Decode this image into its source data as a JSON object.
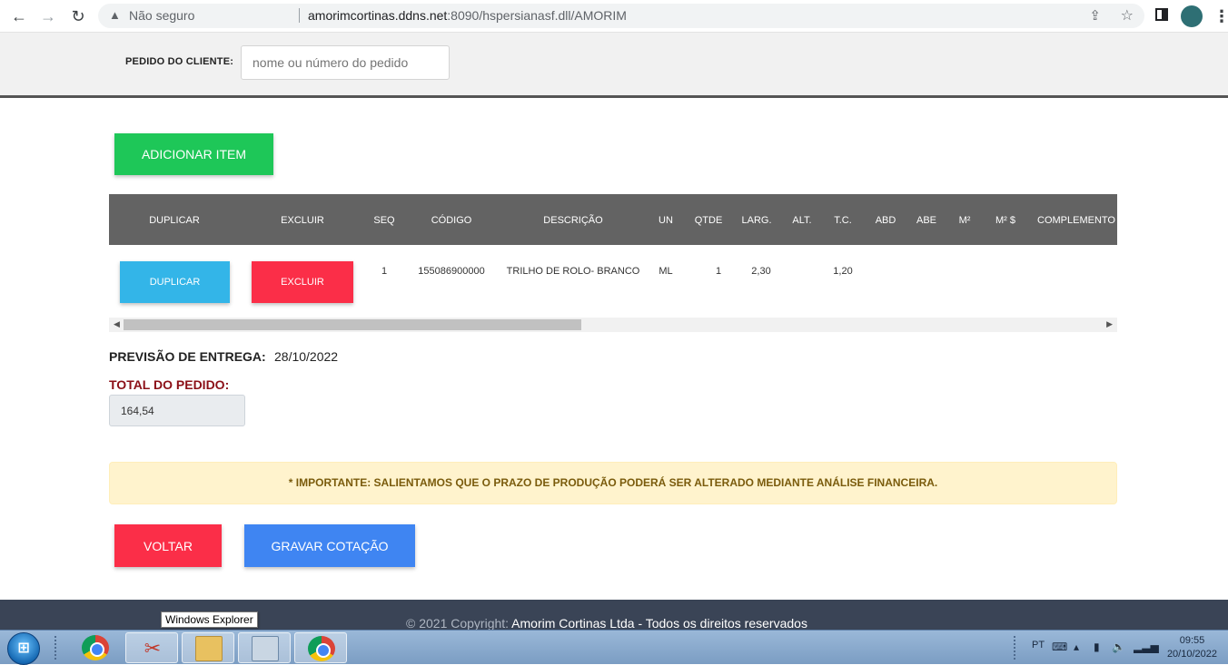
{
  "browser": {
    "security_label": "Não seguro",
    "url_host": "amorimcortinas.ddns.net",
    "url_path": ":8090/hspersianasf.dll/AMORIM"
  },
  "header": {
    "client_order_label": "PEDIDO DO CLIENTE:",
    "client_order_placeholder": "nome ou número do pedido"
  },
  "actions": {
    "add_item": "ADICIONAR ITEM",
    "back": "VOLTAR",
    "save_quote": "GRAVAR COTAÇÃO"
  },
  "table": {
    "columns": [
      "DUPLICAR",
      "EXCLUIR",
      "SEQ",
      "CÓDIGO",
      "DESCRIÇÃO",
      "UN",
      "QTDE",
      "LARG.",
      "ALT.",
      "T.C.",
      "ABD",
      "ABE",
      "M²",
      "M² $",
      "COMPLEMENTO"
    ],
    "rows": [
      {
        "duplicate_label": "DUPLICAR",
        "delete_label": "EXCLUIR",
        "seq": "1",
        "code": "155086900000",
        "description": "TRILHO DE ROLO- BRANCO",
        "unit": "ML",
        "qty": "1",
        "width": "2,30",
        "height": "",
        "tc": "1,20",
        "abd": "",
        "abe": "",
        "m2": "",
        "m2_price": "",
        "complement": ""
      }
    ]
  },
  "summary": {
    "delivery_label": "PREVISÃO DE ENTREGA:",
    "delivery_date": "28/10/2022",
    "total_label": "TOTAL DO PEDIDO:",
    "total_value": "164,54"
  },
  "notice": "* IMPORTANTE: SALIENTAMOS QUE O PRAZO DE PRODUÇÃO PODERÁ SER ALTERADO MEDIANTE ANÁLISE FINANCEIRA.",
  "footer": {
    "copyright_prefix": "© 2021 Copyright: ",
    "company": "Amorim Cortinas Ltda - Todos os direitos reservados"
  },
  "tooltip": "Windows Explorer",
  "taskbar": {
    "language": "PT",
    "time": "09:55",
    "date": "20/10/2022"
  },
  "colors": {
    "add_button": "#1ec758",
    "delete_button": "#fb2e48",
    "duplicate_button": "#33b5e8",
    "save_button": "#3f85f2",
    "table_header": "#636363",
    "footer": "#3a4456",
    "total_label": "#8b0f17"
  }
}
